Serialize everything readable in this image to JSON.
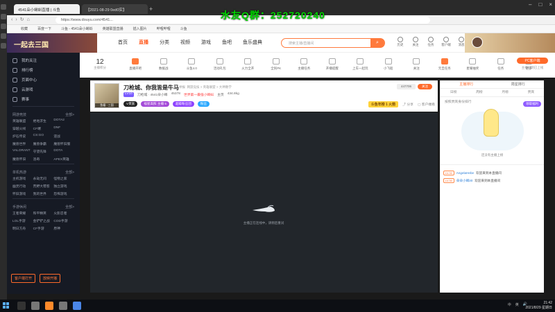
{
  "overlay": {
    "title": "水友Q群：",
    "number": "252720240"
  },
  "browser": {
    "tabs": [
      {
        "label": "4541朵小蝌蚪直播 | 斗鱼"
      },
      {
        "label": "【2021-08-29 0ed0实】"
      }
    ],
    "url": "https://www.douyu.com/4541...",
    "bookmarks": [
      "收藏",
      "百度一下",
      "斗鱼 - 4541朵小蝌蚪",
      "英雄联盟直播",
      "插入图片",
      "哔哩哔哩",
      "斗鱼"
    ]
  },
  "header": {
    "logo_text": "一起去三国",
    "nav": [
      "首页",
      "直播",
      "分类",
      "视频",
      "游戏",
      "鱼吧",
      "鱼乐盛典"
    ],
    "search_placeholder": "搜索主播/直播间",
    "icons": [
      {
        "name": "history-icon",
        "label": "历史"
      },
      {
        "name": "follow-icon",
        "label": "关注"
      },
      {
        "name": "task-icon",
        "label": "任务"
      },
      {
        "name": "client-icon",
        "label": "客户端"
      },
      {
        "name": "message-icon",
        "label": "消息"
      },
      {
        "name": "live-icon",
        "label": "开播"
      }
    ]
  },
  "sidebar": {
    "main_items": [
      "我的关注",
      "排行榜",
      "页面中心",
      "云游戏",
      "赛事"
    ],
    "sections": [
      {
        "title": "网游竞技",
        "more": "全部>",
        "items": [
          "英雄联盟",
          "绝地求生",
          "DOTA2",
          "穿越火线",
          "CF端",
          "DNF",
          "炉石传说",
          "CS:GO",
          "逆战",
          "魔兽世界",
          "魔兽争霸",
          "魔兽怀旧服",
          "VALORANT",
          "守望先锋",
          "DOTA",
          "魔兽怀旧",
          "洛奇",
          "APEX英雄"
        ]
      },
      {
        "title": "单机热游",
        "more": "全部>",
        "items": [
          "主机游戏",
          "永劫无间",
          "怪物之家",
          "幽灵行动",
          "荒野大镖客",
          "独立游戏",
          "怀旧游戏",
          "我的世界",
          "恐怖游戏"
        ]
      },
      {
        "title": "手游休闲",
        "more": "全部>",
        "items": [
          "王者荣耀",
          "和平精英",
          "火影忍者",
          "LOL手游",
          "金铲铲之战",
          "COD手游",
          "明日方舟",
          "CF手游",
          "原神"
        ]
      }
    ],
    "bottom_buttons": [
      "客户端打开",
      "放映开播"
    ]
  },
  "categories": {
    "count": "12",
    "count_label": "主播积分",
    "items": [
      {
        "label": "直播开吧",
        "hot": true
      },
      {
        "label": "数据战"
      },
      {
        "label": "斗鱼4.0"
      },
      {
        "label": "活动礼包"
      },
      {
        "label": "火力全开"
      },
      {
        "label": "全民PK"
      },
      {
        "label": "主播任务"
      },
      {
        "label": "开播提醒"
      },
      {
        "label": "上车一起玩"
      },
      {
        "label": "小飞船"
      },
      {
        "label": "关注"
      },
      {
        "label": "元旦任务"
      },
      {
        "label": "星耀抽奖"
      },
      {
        "label": "任务"
      },
      {
        "label": "更多"
      }
    ],
    "pc_badge": "PC客户端",
    "pc_sub": "主播说明已上线"
  },
  "room": {
    "avatar_tag": "鱼塘 · 三国",
    "title": "刀枪城、你我皆是牛马",
    "report": "举报",
    "tags": "网游竞技 > 英雄联盟 > 大神教学",
    "level": "LV10",
    "streamer": "刀枪城 · 4541朵小蝌",
    "viewers": "45378",
    "hot_rank": "世界第一最强小蝌蚪",
    "room_no": "主页",
    "popularity": "434.8kg",
    "badges": [
      "V贵族",
      "福星高照 主播 5",
      "超级粉丝团",
      "粉丝"
    ],
    "fans_count": "447706",
    "follow_label": "关注",
    "gold_badge": "斗鱼年榜 1 火箭",
    "share_label": "分享",
    "client_label": "客户端看"
  },
  "player": {
    "loading_text": "主播正在连线中，请稍后重试"
  },
  "rpanel": {
    "tabs": [
      "主播排行",
      "周星排行"
    ],
    "subtabs": [
      "日榜",
      "周榜",
      "月榜",
      "贵宾"
    ],
    "gift_btn": "领取福利",
    "note": "按照贵宾身份排行",
    "empty_text": "还没有主播上榜",
    "messages": [
      {
        "badge": "LV.31",
        "user": "AngelaHebe",
        "text": "欢迎来到本直播间"
      },
      {
        "badge": "LV.30",
        "user": "朵朵小蝌30",
        "text": "欢迎来到本直播间"
      }
    ]
  },
  "taskbar": {
    "tray": [
      "中",
      "英"
    ],
    "time": "21:42",
    "date": "2021/8/29 星期日"
  }
}
